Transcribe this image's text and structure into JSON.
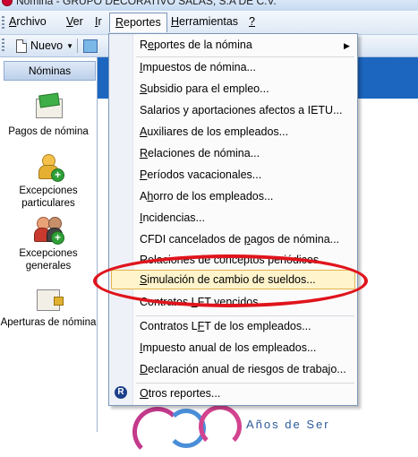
{
  "window": {
    "title": "Nómina - GRUPO DECORATIVO SALAS, S.A DE C.V."
  },
  "menubar": {
    "archivo": {
      "pre": "",
      "u": "A",
      "post": "rchivo"
    },
    "ver": {
      "pre": "",
      "u": "V",
      "post": "er"
    },
    "ir": {
      "pre": "",
      "u": "I",
      "post": "r"
    },
    "reportes": {
      "pre": "",
      "u": "R",
      "post": "eportes"
    },
    "herramientas": {
      "pre": "",
      "u": "H",
      "post": "erramientas"
    },
    "help": {
      "pre": "",
      "u": "?",
      "post": ""
    }
  },
  "toolbar": {
    "new_label": "Nuevo"
  },
  "sidebar": {
    "header": "Nóminas",
    "items": [
      {
        "label": "Pagos de nómina",
        "icon": "envelope-money-icon"
      },
      {
        "label": "Excepciones particulares",
        "icon": "person-add-icon"
      },
      {
        "label": "Excepciones generales",
        "icon": "group-add-icon"
      },
      {
        "label": "Aperturas de nómina",
        "icon": "payroll-lock-icon"
      }
    ]
  },
  "reportes_menu": {
    "items": [
      {
        "pre": "R",
        "u": "e",
        "post": "portes de la nómina",
        "submenu": true
      },
      {
        "pre": "",
        "u": "I",
        "post": "mpuestos de nómina..."
      },
      {
        "pre": "",
        "u": "S",
        "post": "ubsidio para el empleo..."
      },
      {
        "pre": "Salarios y aportaciones afectos a IETU...",
        "u": "",
        "post": ""
      },
      {
        "pre": "",
        "u": "A",
        "post": "uxiliares de los empleados..."
      },
      {
        "pre": "",
        "u": "R",
        "post": "elaciones de nómina..."
      },
      {
        "pre": "",
        "u": "P",
        "post": "eríodos vacacionales..."
      },
      {
        "pre": "A",
        "u": "h",
        "post": "orro de los empleados..."
      },
      {
        "pre": "",
        "u": "I",
        "post": "ncidencias..."
      },
      {
        "pre": "CFDI cancelados de ",
        "u": "p",
        "post": "agos de nómina..."
      },
      {
        "pre": "Relaciones de conceptos periódicos...",
        "u": "",
        "post": ""
      },
      {
        "pre": "",
        "u": "S",
        "post": "imulación de cambio de sueldos..."
      },
      {
        "pre": "Contratos ",
        "u": "L",
        "post": "FT vencidos"
      },
      {
        "pre": "Contratos L",
        "u": "F",
        "post": "T de los empleados..."
      },
      {
        "pre": "",
        "u": "I",
        "post": "mpuesto anual de los empleados..."
      },
      {
        "pre": "",
        "u": "D",
        "post": "eclaración anual de riesgos de trabajo..."
      },
      {
        "pre": "",
        "u": "O",
        "post": "tros reportes..."
      }
    ],
    "highlighted_index": 11
  },
  "background": {
    "logo_text": "Años de Ser"
  },
  "colors": {
    "main_blue": "#1c66bf",
    "highlight": "#fff4cc",
    "annotation": "#e0141c"
  }
}
